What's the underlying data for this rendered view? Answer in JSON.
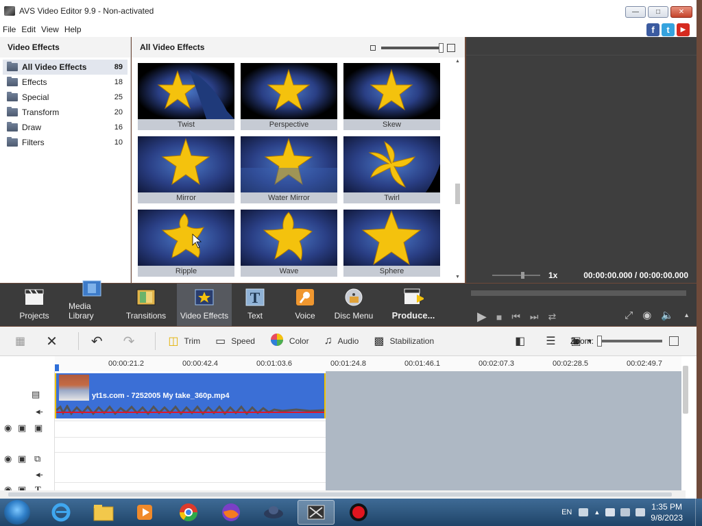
{
  "window": {
    "title": "AVS Video Editor 9.9 - Non-activated"
  },
  "menu": [
    "File",
    "Edit",
    "View",
    "Help"
  ],
  "social": {
    "facebook": "f",
    "twitter": "t",
    "youtube": "▶"
  },
  "left_panel": {
    "title": "Video Effects",
    "categories": [
      {
        "label": "All Video Effects",
        "count": "89"
      },
      {
        "label": "Effects",
        "count": "18"
      },
      {
        "label": "Special",
        "count": "25"
      },
      {
        "label": "Transform",
        "count": "20"
      },
      {
        "label": "Draw",
        "count": "16"
      },
      {
        "label": "Filters",
        "count": "10"
      }
    ]
  },
  "effects_panel": {
    "title": "All Video Effects",
    "effects": [
      "Twist",
      "Perspective",
      "Skew",
      "Mirror",
      "Water Mirror",
      "Twirl",
      "Ripple",
      "Wave",
      "Sphere"
    ]
  },
  "preview": {
    "speed": "1x",
    "timecode": "00:00:00.000 / 00:00:00.000"
  },
  "main_toolbar": [
    "Projects",
    "Media Library",
    "Transitions",
    "Video Effects",
    "Text",
    "Voice",
    "Disc Menu",
    "Produce..."
  ],
  "edit_toolbar": {
    "trim": "Trim",
    "speed": "Speed",
    "color": "Color",
    "audio": "Audio",
    "stabilization": "Stabilization",
    "zoom": "Zoom:"
  },
  "timeline": {
    "ticks": [
      "00:00:21.2",
      "00:00:42.4",
      "00:01:03.6",
      "00:01:24.8",
      "00:01:46.1",
      "00:02:07.3",
      "00:02:28.5",
      "00:02:49.7"
    ],
    "clip_name": "yt1s.com - 7252005 My take_360p.mp4"
  },
  "taskbar": {
    "lang": "EN",
    "time": "1:35 PM",
    "date": "9/8/2023"
  },
  "colors": {
    "accent": "#3b6fd6",
    "toolbar_bg": "#3b3b3b",
    "preview_bg": "#3e3e3e",
    "clip_border": "#f1c400"
  }
}
